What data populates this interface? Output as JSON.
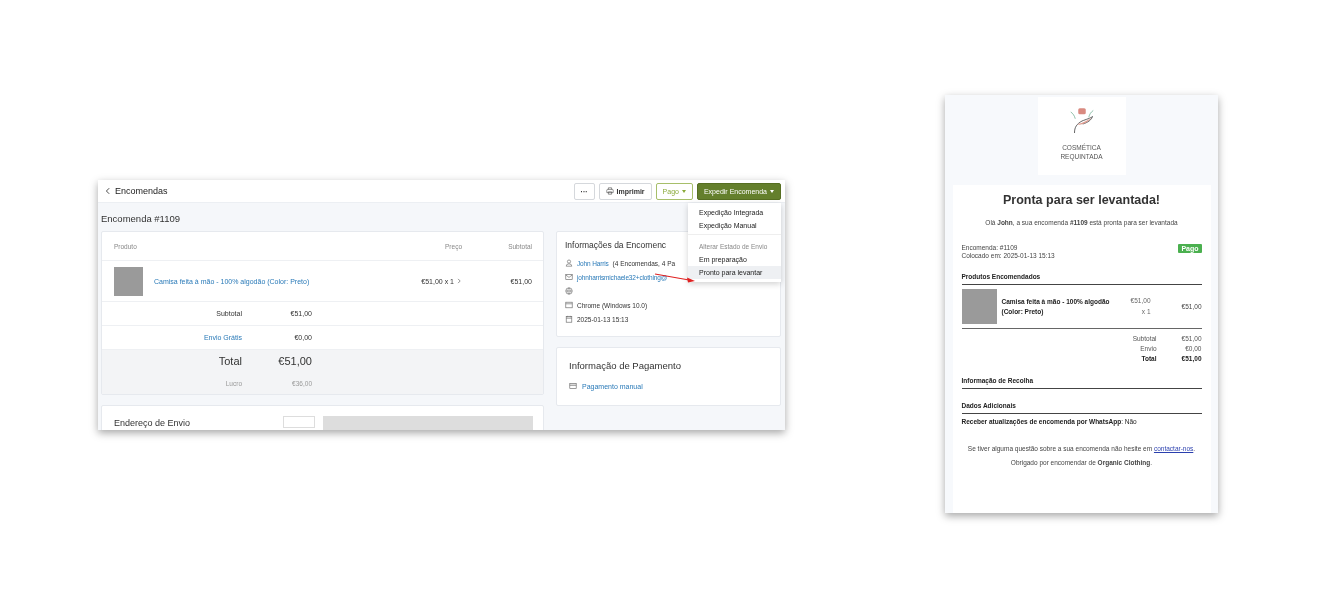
{
  "admin": {
    "back_link": "Encomendas",
    "toolbar": {
      "more": "···",
      "print": "Imprimir",
      "status": "Pago",
      "ship": "Expedir Encomenda"
    },
    "ship_menu": [
      {
        "label": "Expedição Integrada",
        "kind": "item",
        "selected": false
      },
      {
        "label": "Expedição Manual",
        "kind": "item",
        "selected": false
      },
      {
        "label": "Alterar Estado de Envio",
        "kind": "header"
      },
      {
        "label": "Em preparação",
        "kind": "item",
        "selected": false
      },
      {
        "label": "Pronto para levantar",
        "kind": "item",
        "selected": true
      }
    ],
    "order_title": "Encomenda #1109",
    "products_table": {
      "columns": [
        "Produto",
        "Preço",
        "Subtotal"
      ],
      "rows": [
        {
          "name": "Camisa feita à mão - 100% algodão (Color: Preto)",
          "price": "€51,00 x 1",
          "subtotal": "€51,00"
        }
      ]
    },
    "totals": [
      {
        "label": "Subtotal",
        "value": "€51,00",
        "kind": "plain"
      },
      {
        "label": "Envio Grátis",
        "value": "€0,00",
        "kind": "link"
      },
      {
        "label": "Total",
        "value": "€51,00",
        "kind": "total"
      },
      {
        "label": "Lucro",
        "value": "€36,00",
        "kind": "muted"
      }
    ],
    "order_info": {
      "title": "Informações da Encomenc",
      "lines": [
        {
          "kind": "customer",
          "link": "John Harris",
          "text": "(4 Encomendas, 4 Pa"
        },
        {
          "kind": "email",
          "link": "johnharrismichaele32+clothing@"
        },
        {
          "kind": "ip"
        },
        {
          "kind": "browser",
          "text": "Chrome (Windows 10.0)"
        },
        {
          "kind": "date",
          "text": "2025-01-13 15:13"
        }
      ]
    },
    "payment": {
      "title": "Informação de Pagamento",
      "method": "Pagamento manual"
    },
    "shipping_address": {
      "title": "Endereço de Envio"
    }
  },
  "email": {
    "logo_lines": [
      "COSMÉTICA",
      "REQUINTADA"
    ],
    "heading": "Pronta para ser levantada!",
    "greeting": "Olá **John**, a sua encomenda **#1109** está pronta para ser levantada",
    "order_number": "Encomenda: #1109",
    "placed": "Colocado em: 2025-01-13 15:13",
    "status": "Pago",
    "products_title": "Produtos Encomendados",
    "items": [
      {
        "name": "Camisa feita à mão - 100% algodão (Color: Preto)",
        "unit_price": "€51,00",
        "quantity": "x 1",
        "total": "€51,00"
      }
    ],
    "totals": [
      {
        "label": "Subtotal",
        "value": "€51,00",
        "kind": "plain"
      },
      {
        "label": "Envio",
        "value": "€0,00",
        "kind": "plain"
      },
      {
        "label": "Total",
        "value": "€51,00",
        "kind": "total"
      }
    ],
    "pickup_title": "Informação de Recolha",
    "additional_title": "Dados Adicionais",
    "whatsapp": "**Receber atualizações de encomenda por WhatsApp**: Não",
    "footer": {
      "before": "Se tiver alguma questão sobre a sua encomenda não hesite em ",
      "link": "contactar-nos",
      "after": "."
    },
    "thanks": "Obrigado por encomendar de **Organic Clothing**."
  }
}
